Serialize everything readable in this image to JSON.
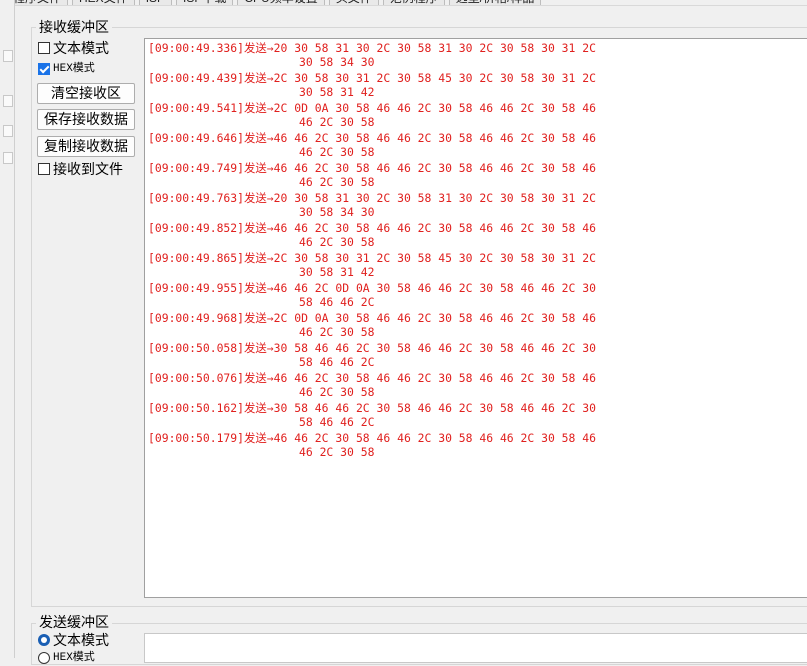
{
  "top_tabs": [
    "程序文件",
    "HEX文件",
    "ISP",
    "ISP下载",
    "CPU频率设置",
    "头文件",
    "范例程序",
    "选型/价格/样品"
  ],
  "receive": {
    "title": "接收缓冲区",
    "text_mode_label": "文本模式",
    "text_mode_checked": false,
    "hex_mode_label": "HEX模式",
    "hex_mode_checked": true,
    "clear_button": "清空接收区",
    "save_button": "保存接收数据",
    "copy_button": "复制接收数据",
    "to_file_label": "接收到文件",
    "to_file_checked": false,
    "lines": [
      {
        "head": "[09:00:49.336]发送→20 30 58 31 30 2C 30 58 31 30 2C 30 58 30 31 2C",
        "cont": "30 58 34 30"
      },
      {
        "head": "[09:00:49.439]发送→2C 30 58 30 31 2C 30 58 45 30 2C 30 58 30 31 2C",
        "cont": "30 58 31 42"
      },
      {
        "head": "[09:00:49.541]发送→2C 0D 0A 30 58 46 46 2C 30 58 46 46 2C 30 58 46",
        "cont": "46 2C 30 58"
      },
      {
        "head": "[09:00:49.646]发送→46 46 2C 30 58 46 46 2C 30 58 46 46 2C 30 58 46",
        "cont": "46 2C 30 58"
      },
      {
        "head": "[09:00:49.749]发送→46 46 2C 30 58 46 46 2C 30 58 46 46 2C 30 58 46",
        "cont": "46 2C 30 58"
      },
      {
        "head": "[09:00:49.763]发送→20 30 58 31 30 2C 30 58 31 30 2C 30 58 30 31 2C",
        "cont": "30 58 34 30"
      },
      {
        "head": "[09:00:49.852]发送→46 46 2C 30 58 46 46 2C 30 58 46 46 2C 30 58 46",
        "cont": "46 2C 30 58"
      },
      {
        "head": "[09:00:49.865]发送→2C 30 58 30 31 2C 30 58 45 30 2C 30 58 30 31 2C",
        "cont": "30 58 31 42"
      },
      {
        "head": "[09:00:49.955]发送→46 46 2C 0D 0A 30 58 46 46 2C 30 58 46 46 2C 30",
        "cont": "58 46 46 2C"
      },
      {
        "head": "[09:00:49.968]发送→2C 0D 0A 30 58 46 46 2C 30 58 46 46 2C 30 58 46",
        "cont": "46 2C 30 58"
      },
      {
        "head": "[09:00:50.058]发送→30 58 46 46 2C 30 58 46 46 2C 30 58 46 46 2C 30",
        "cont": "58 46 46 2C"
      },
      {
        "head": "[09:00:50.076]发送→46 46 2C 30 58 46 46 2C 30 58 46 46 2C 30 58 46",
        "cont": "46 2C 30 58"
      },
      {
        "head": "[09:00:50.162]发送→30 58 46 46 2C 30 58 46 46 2C 30 58 46 46 2C 30",
        "cont": "58 46 46 2C"
      },
      {
        "head": "[09:00:50.179]发送→46 46 2C 30 58 46 46 2C 30 58 46 46 2C 30 58 46",
        "cont": "46 2C 30 58"
      }
    ]
  },
  "send": {
    "title": "发送缓冲区",
    "text_mode_label": "文本模式",
    "text_mode_selected": true,
    "hex_mode_label": "HEX模式",
    "hex_mode_selected": false
  },
  "colors": {
    "received_text": "#e0201e",
    "checkbox_checked": "#1a73e8"
  }
}
